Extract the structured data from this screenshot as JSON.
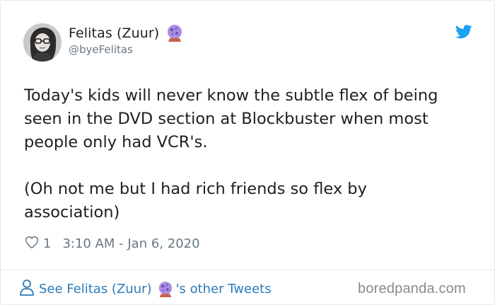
{
  "tweet": {
    "author": {
      "display_name": "Felitas (Zuur)",
      "name_emoji_icon": "crystal-ball-icon",
      "handle": "@byeFelitas",
      "avatar_icon": "avatar-photo"
    },
    "brand_icon": "twitter-bird-icon",
    "text": "Today's kids will never know the subtle flex of being\nseen in the DVD section at Blockbuster when most\npeople only had VCR's.\n\n(Oh not me but I had rich friends so flex by\nassociation)",
    "like_icon": "heart-icon",
    "likes": "1",
    "timestamp": "3:10 AM - Jan 6, 2020"
  },
  "footer": {
    "link_prefix": "See Felitas (Zuur)",
    "link_suffix": "'s other Tweets",
    "link_icon": "person-icon",
    "watermark": "boredpanda.com"
  },
  "colors": {
    "text": "#1c2022",
    "secondary": "#697882",
    "link": "#2b7bb9",
    "twitter_blue": "#1da1f2",
    "border": "#e1e8ed"
  }
}
